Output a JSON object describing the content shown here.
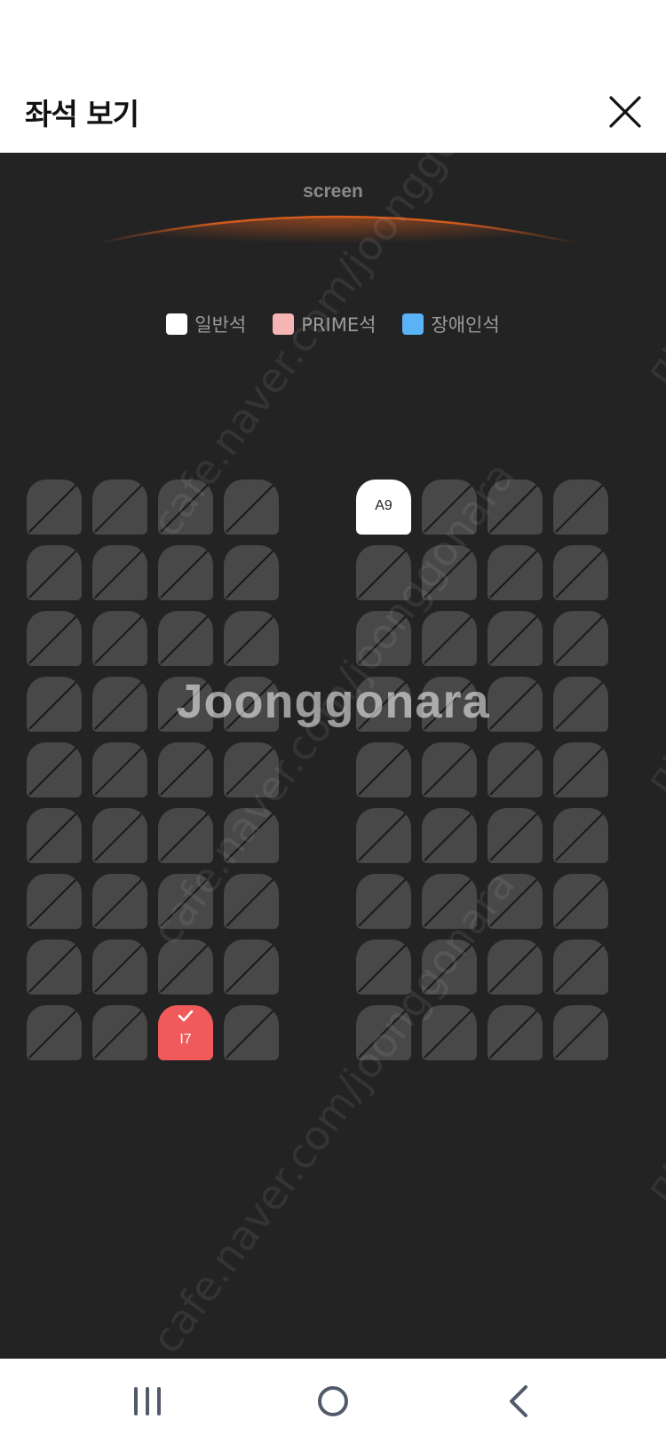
{
  "header": {
    "title": "좌석 보기"
  },
  "screen": {
    "label": "screen",
    "glow_color": "#e0601e"
  },
  "legend": [
    {
      "label": "일반석",
      "color": "#ffffff"
    },
    {
      "label": "PRIME석",
      "color": "#f6b4b4"
    },
    {
      "label": "장애인석",
      "color": "#5ab2f7"
    }
  ],
  "seat_colors": {
    "unavailable": "#484848",
    "available": "#ffffff",
    "selected": "#f05a5a"
  },
  "seating": {
    "rows": 9,
    "left_block_columns": 4,
    "right_block_columns": 4,
    "available_seats": [
      {
        "label": "A9",
        "row": 1,
        "block": "right",
        "col": 1
      }
    ],
    "selected_seats": [
      {
        "label": "I7",
        "row": 9,
        "block": "left",
        "col": 3
      }
    ]
  },
  "watermark": {
    "url": "cafe.naver.com/joonggonara",
    "logo": "Joonggonara",
    "side": "미"
  },
  "nav": {
    "icons": [
      "recent-apps-icon",
      "home-icon",
      "back-icon"
    ]
  }
}
